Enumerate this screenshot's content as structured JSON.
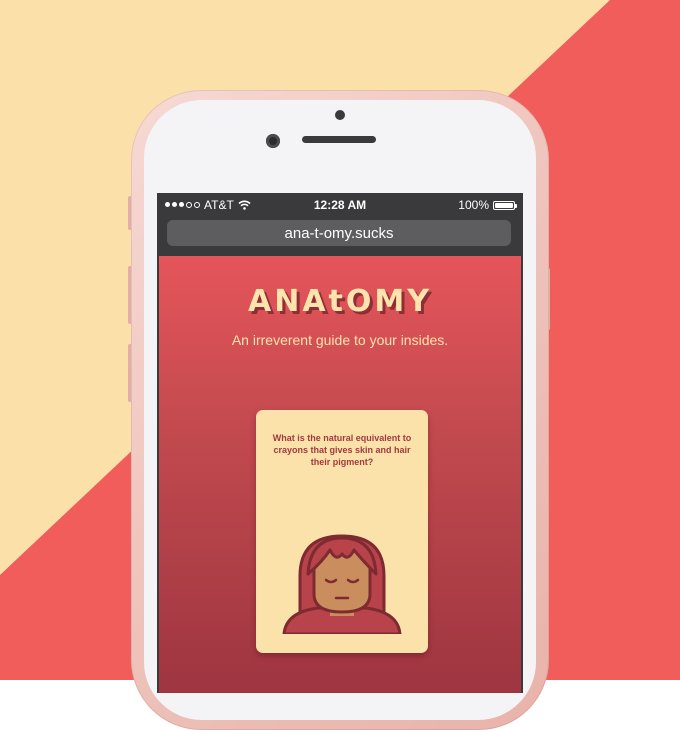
{
  "colors": {
    "background_cream": "#fbe1a9",
    "background_red": "#f15d5a",
    "brand_red": "#e5555a",
    "card_cream": "#fbe2aa"
  },
  "status_bar": {
    "carrier": "AT&T",
    "time": "12:28 AM",
    "battery": "100%",
    "signal_icon": "signal-dots-icon",
    "wifi_icon": "wifi-icon",
    "battery_icon": "battery-icon"
  },
  "browser": {
    "url": "ana-t-omy.sucks"
  },
  "page": {
    "logo": "ANAtOMY",
    "tagline": "An irreverent guide to your insides."
  },
  "card": {
    "question": "What is the natural equivalent to crayons that gives skin and hair their pigment?",
    "illustration_icon": "face-illustration-icon"
  }
}
